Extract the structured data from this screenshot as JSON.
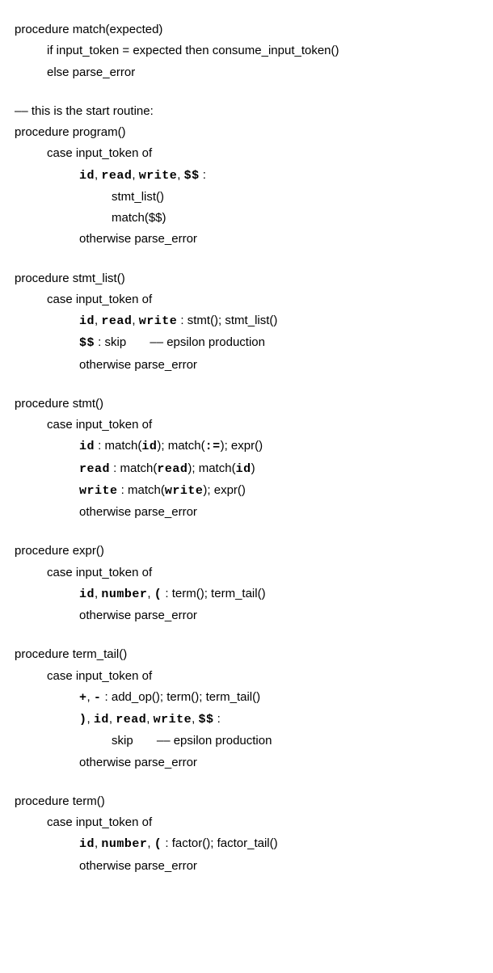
{
  "match": {
    "header": "procedure match(expected)",
    "l1a": "if input",
    "l1b": "token = expected then consume",
    "l1c": "input",
    "l1d": "token()",
    "l2a": "else parse",
    "l2b": "error"
  },
  "comment": "–– this is the start routine:",
  "program": {
    "header": "procedure program()",
    "case_a": "case input",
    "case_b": "token of",
    "tok_id": "id",
    "tok_read": "read",
    "tok_write": "write",
    "tok_dd": "$$",
    "colon": " :",
    "stmtlist_a": "stmt",
    "stmtlist_b": "list()",
    "match_dd": "match($$)",
    "otherwise_a": "otherwise parse",
    "otherwise_b": "error"
  },
  "stmtlist": {
    "header_a": "procedure stmt",
    "header_b": "list()",
    "case_a": "case input",
    "case_b": "token of",
    "l1_tokens_a": "id",
    "l1_tokens_b": "read",
    "l1_tokens_c": "write",
    "l1_body_a": " : stmt(); stmt",
    "l1_body_b": "list()",
    "l2_tok": "$$",
    "l2_body": " : skip       –– epsilon production",
    "otherwise_a": "otherwise parse",
    "otherwise_b": "error"
  },
  "stmt": {
    "header": "procedure stmt()",
    "case_a": "case input",
    "case_b": "token of",
    "l1_tok": "id",
    "l1_a": " : match(",
    "l1_b": "id",
    "l1_c": "); match(",
    "l1_d": ":=",
    "l1_e": "); expr()",
    "l2_tok": "read",
    "l2_a": " : match(",
    "l2_b": "read",
    "l2_c": "); match(",
    "l2_d": "id",
    "l2_e": ")",
    "l3_tok": "write",
    "l3_a": " : match(",
    "l3_b": "write",
    "l3_c": "); expr()",
    "otherwise_a": "otherwise parse",
    "otherwise_b": "error"
  },
  "expr": {
    "header": "procedure expr()",
    "case_a": "case input",
    "case_b": "token of",
    "tok_a": "id",
    "tok_b": "number",
    "tok_c": "(",
    "body_a": " : term(); term",
    "body_b": "tail()",
    "otherwise_a": "otherwise parse",
    "otherwise_b": "error"
  },
  "termtail": {
    "header_a": "procedure term",
    "header_b": "tail()",
    "case_a": "case input",
    "case_b": "token of",
    "l1_tok_a": "+",
    "l1_tok_b": "-",
    "l1_body_a": " : add",
    "l1_body_b": "op(); term(); term",
    "l1_body_c": "tail()",
    "l2_tok_a": ")",
    "l2_tok_b": "id",
    "l2_tok_c": "read",
    "l2_tok_d": "write",
    "l2_tok_e": "$$",
    "l2_colon": " :",
    "l3_body": "skip       –– epsilon production",
    "otherwise_a": "otherwise parse",
    "otherwise_b": "error"
  },
  "term": {
    "header": "procedure term()",
    "case_a": "case input",
    "case_b": "token of",
    "tok_a": "id",
    "tok_b": "number",
    "tok_c": "(",
    "body_a": " : factor(); factor",
    "body_b": "tail()",
    "otherwise_a": "otherwise parse",
    "otherwise_b": "error"
  },
  "sep": ", ",
  "underscore": "_"
}
